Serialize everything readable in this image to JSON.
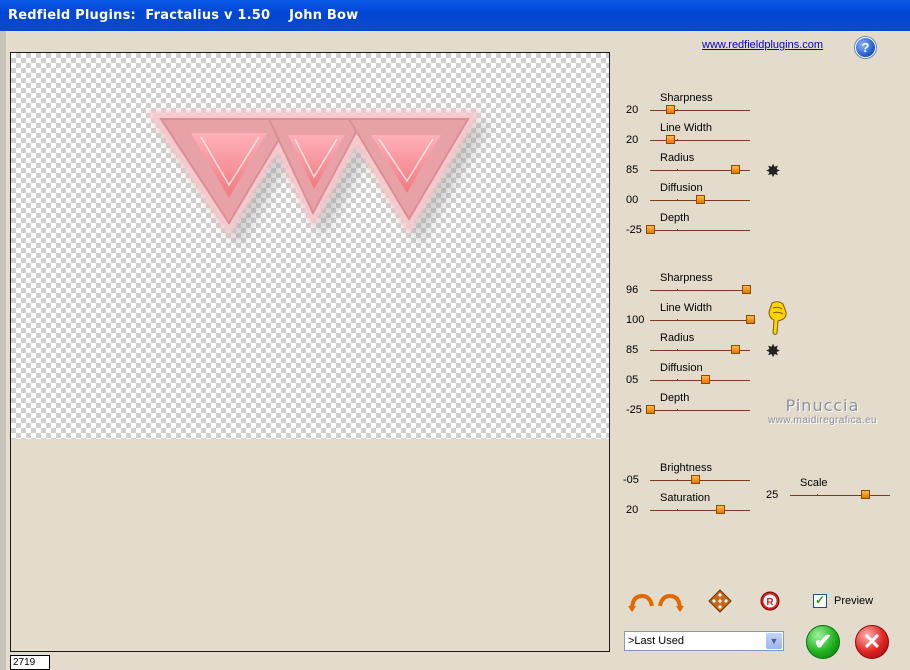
{
  "window": {
    "title": "Redfield Plugins:  Fractalius v 1.50    John Bow"
  },
  "header": {
    "link": "www.redfieldplugins.com",
    "help_icon": "?"
  },
  "group1": {
    "sliders": [
      {
        "label": "Sharpness",
        "value": "20",
        "level": 0.2
      },
      {
        "label": "Line Width",
        "value": "20",
        "level": 0.2
      },
      {
        "label": "Radius",
        "value": "85",
        "level": 0.85
      },
      {
        "label": "Diffusion",
        "value": "00",
        "level": 0.5
      },
      {
        "label": "Depth",
        "value": "-25",
        "level": 0.0
      }
    ]
  },
  "group2": {
    "sliders": [
      {
        "label": "Sharpness",
        "value": "96",
        "level": 0.96
      },
      {
        "label": "Line Width",
        "value": "100",
        "level": 1.0
      },
      {
        "label": "Radius",
        "value": "85",
        "level": 0.85
      },
      {
        "label": "Diffusion",
        "value": "05",
        "level": 0.55
      },
      {
        "label": "Depth",
        "value": "-25",
        "level": 0.0
      }
    ]
  },
  "group3": {
    "brightness": {
      "label": "Brightness",
      "value": "-05",
      "level": 0.45
    },
    "saturation": {
      "label": "Saturation",
      "value": "20",
      "level": 0.7
    },
    "scale": {
      "label": "Scale",
      "value": "25",
      "level": 0.75
    }
  },
  "watermark": {
    "line1": "Pinuccia",
    "line2": "www.maidiregrafica.eu"
  },
  "footer": {
    "preview_label": "Preview",
    "preview_checked": true,
    "preset_selected": ">Last Used",
    "status_value": "2719"
  },
  "colors": {
    "titlebar": "#0346d6",
    "thumb": "#f09a20",
    "track": "#7a3b1e",
    "accent_pink": "#f07a80"
  }
}
